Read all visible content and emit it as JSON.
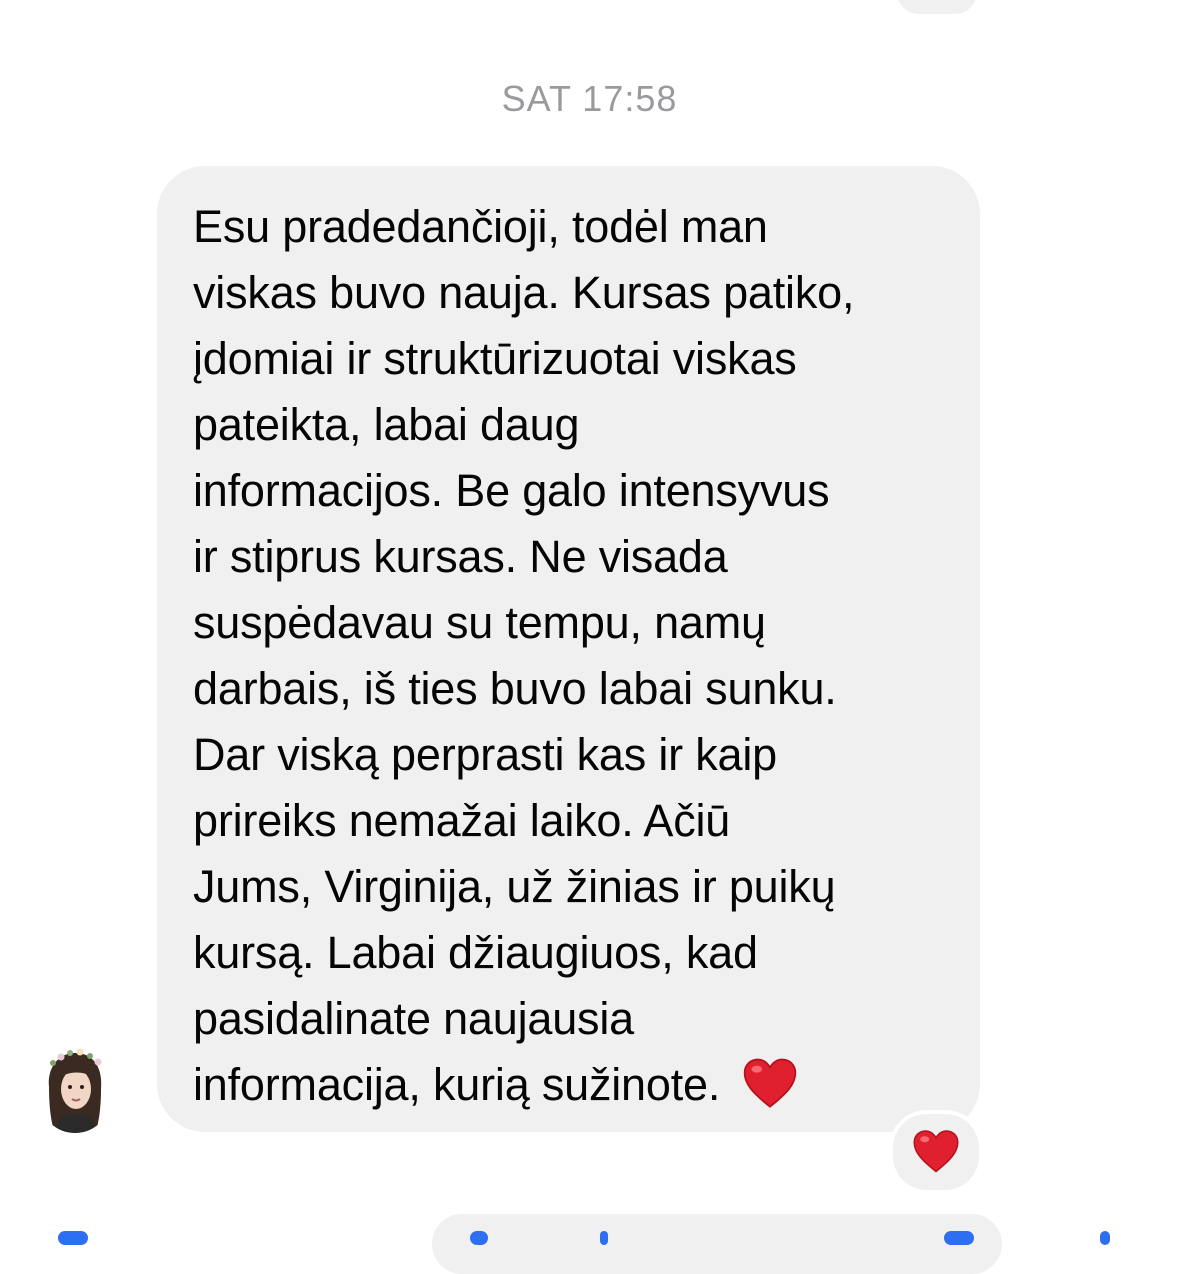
{
  "conversation": {
    "timestamp": "SAT 17:58",
    "message": {
      "lines": [
        "Esu pradedančioji, todėl man",
        "viskas buvo nauja. Kursas patiko,",
        "įdomiai ir struktūrizuotai viskas",
        "pateikta, labai daug",
        "informacijos. Be galo intensyvus",
        "ir stiprus kursas. Ne visada",
        "suspėdavau su tempu, namų",
        "darbais, iš ties buvo labai sunku.",
        "Dar viską perprasti kas ir kaip",
        "prireiks nemažai laiko. Ačiū",
        "Jums, Virginija, už žinias ir puikų",
        "kursą. Labai džiaugiuos, kad",
        "pasidalinate naujausia",
        "informacija, kurią sužinote."
      ],
      "emoji": "red-heart",
      "reaction": "red-heart"
    },
    "sender_avatar": "avatar-woman-flower-crown"
  },
  "colors": {
    "bubble_background": "#f0f0f0",
    "timestamp_text": "#9a9a9e",
    "message_text": "#050505",
    "heart_red": "#e0202e",
    "accent_blue": "#2e6ff2"
  }
}
